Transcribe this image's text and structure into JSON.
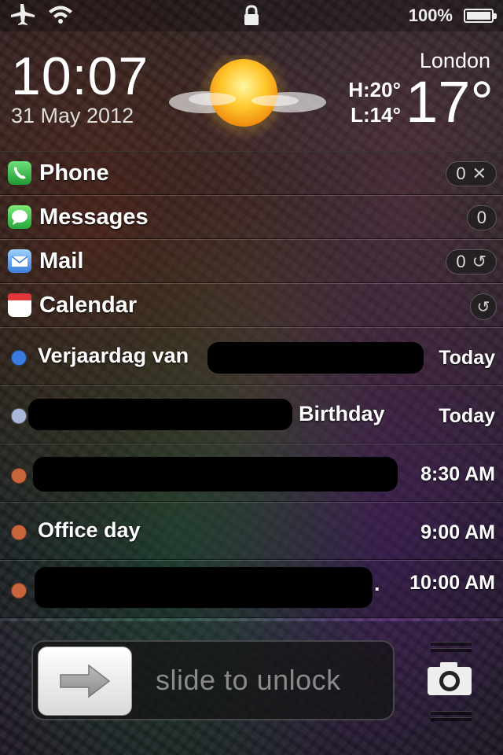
{
  "status_bar": {
    "airplane_icon": "airplane-icon",
    "wifi_icon": "wifi-icon",
    "lock_icon": "lock-icon",
    "battery_percent": "100%",
    "battery_level": 1.0
  },
  "lock_screen": {
    "time": "10:07",
    "date": "31 May 2012"
  },
  "weather": {
    "icon": "partly-sunny-icon",
    "high": "H:20°",
    "low": "L:14°",
    "city": "London",
    "temperature": "17°"
  },
  "notifications": {
    "apps": [
      {
        "name": "Phone",
        "count": "0",
        "action": "clear"
      },
      {
        "name": "Messages",
        "count": "0",
        "action": "none"
      },
      {
        "name": "Mail",
        "count": "0",
        "action": "refresh"
      },
      {
        "name": "Calendar",
        "count": "",
        "action": "refresh"
      }
    ],
    "events": [
      {
        "title": "Verjaardag van",
        "time": "Today",
        "color": "#3a7be0"
      },
      {
        "title": "Birthday",
        "time": "Today",
        "color": "#a9b8d8"
      },
      {
        "title": "",
        "time": "8:30 AM",
        "color": "#c8643c"
      },
      {
        "title": "Office day",
        "time": "9:00 AM",
        "color": "#c8643c"
      },
      {
        "title": ".",
        "time": "10:00 AM",
        "color": "#c8643c"
      }
    ]
  },
  "unlock": {
    "label": "slide to unlock",
    "camera_icon": "camera-icon"
  },
  "colors": {
    "phone_icon": "#2fb84a",
    "messages_icon": "#34c04a",
    "mail_icon": "#4a8fe0",
    "calendar_icon": "#ffffff"
  }
}
